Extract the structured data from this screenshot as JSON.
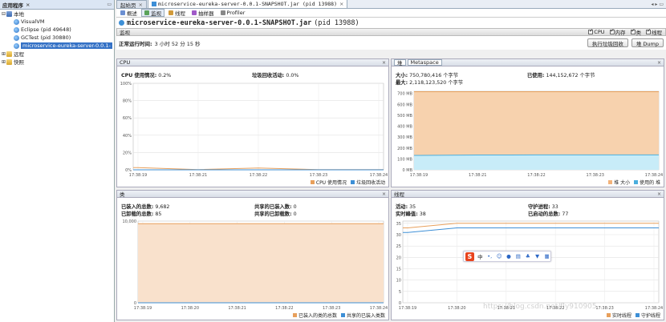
{
  "left_panel": {
    "title": "应用程序",
    "tree": [
      {
        "label": "本地",
        "level": 0,
        "twist": "⊟",
        "icon": "host-icon",
        "selected": false
      },
      {
        "label": "VisualVM",
        "level": 1,
        "twist": "",
        "icon": "app-icon",
        "selected": false
      },
      {
        "label": "Eclipse (pid 49648)",
        "level": 1,
        "twist": "",
        "icon": "app-icon",
        "selected": false
      },
      {
        "label": "GCTest (pid 30880)",
        "level": 1,
        "twist": "",
        "icon": "app-icon",
        "selected": false
      },
      {
        "label": "microservice-eureka-server-0.0.1-",
        "level": 1,
        "twist": "",
        "icon": "app-icon",
        "selected": true
      },
      {
        "label": "远程",
        "level": 0,
        "twist": "⊞",
        "icon": "folder-icon",
        "selected": false
      },
      {
        "label": "快照",
        "level": 0,
        "twist": "⊞",
        "icon": "folder-icon",
        "selected": false
      }
    ]
  },
  "doc_tabs": [
    {
      "label": "起始页",
      "active": false
    },
    {
      "label": "microservice-eureka-server-0.0.1-SNAPSHOT.jar (pid 13988)",
      "active": true
    }
  ],
  "sub_tabs": [
    {
      "label": "概述",
      "active": false,
      "color": "#6b8fd1"
    },
    {
      "label": "监视",
      "active": true,
      "color": "#5aa35a"
    },
    {
      "label": "线程",
      "active": false,
      "color": "#d19a3a"
    },
    {
      "label": "抽样器",
      "active": false,
      "color": "#a05ac8"
    },
    {
      "label": "Profiler",
      "active": false,
      "color": "#888888"
    }
  ],
  "app_title": {
    "name": "microservice-eureka-server-0.0.1-SNAPSHOT.jar",
    "pid": "(pid 13988)"
  },
  "monitor_bar": {
    "label": "监视",
    "checks": [
      {
        "label": "CPU",
        "checked": true
      },
      {
        "label": "内存",
        "checked": true
      },
      {
        "label": "类",
        "checked": true
      },
      {
        "label": "线程",
        "checked": true
      }
    ]
  },
  "uptime": {
    "label": "正常运行时间:",
    "value": "3 小时 52 分 15 秒"
  },
  "buttons": {
    "gc": "执行垃圾回收",
    "heap_dump": "堆 Dump"
  },
  "cpu_panel": {
    "title": "CPU",
    "cpu_usage_label": "CPU 使用情况:",
    "cpu_usage_value": "0.2%",
    "gc_label": "垃圾回收活动:",
    "gc_value": "0.0%",
    "legend": [
      {
        "label": "CPU 使用情况",
        "color": "#e8a05c"
      },
      {
        "label": "垃圾回收活动",
        "color": "#3d8fd6"
      }
    ]
  },
  "heap_panel": {
    "tab_heap": "堆",
    "tab_meta": "Metaspace",
    "size_label": "大小:",
    "size_value": "750,780,416 个字节",
    "used_label": "已使用:",
    "used_value": "144,152,672 个字节",
    "max_label": "最大:",
    "max_value": "2,118,123,520 个字节",
    "legend": [
      {
        "label": "堆 大小",
        "color": "#f2b27a"
      },
      {
        "label": "使用的 堆",
        "color": "#4aaedd"
      }
    ]
  },
  "classes_panel": {
    "title": "类",
    "loaded_label": "已装入的总数:",
    "loaded_value": "9,682",
    "unloaded_label": "已卸载的总数:",
    "unloaded_value": "85",
    "shared_loaded_label": "共享的已装入数:",
    "shared_loaded_value": "0",
    "shared_unloaded_label": "共享的已卸载数:",
    "shared_unloaded_value": "0",
    "legend": [
      {
        "label": "已装入的类的总数",
        "color": "#e8a05c"
      },
      {
        "label": "共享的已装入类数",
        "color": "#3d8fd6"
      }
    ]
  },
  "threads_panel": {
    "title": "线程",
    "live_label": "活动:",
    "live_value": "35",
    "daemon_label": "守护进程:",
    "daemon_value": "33",
    "peak_label": "实时峰值:",
    "peak_value": "38",
    "started_label": "已启动的总数:",
    "started_value": "77",
    "legend": [
      {
        "label": "实时线程",
        "color": "#e8a05c"
      },
      {
        "label": "守护线程",
        "color": "#3d8fd6"
      }
    ]
  },
  "ime_toolbar": {
    "logo": "S",
    "mode": "中"
  },
  "watermark": "https://blog.csdn.net/fly910905",
  "chart_data": [
    {
      "type": "line",
      "title": "CPU",
      "x": [
        "17:38:19",
        "17:38:21",
        "17:38:22",
        "17:38:23",
        "17:38:24"
      ],
      "yticks": [
        "0%",
        "20%",
        "40%",
        "60%",
        "80%",
        "100%"
      ],
      "ylim": [
        0,
        100
      ],
      "series": [
        {
          "name": "CPU 使用情况",
          "values": [
            2.5,
            0.3,
            2.0,
            0.2,
            0.2
          ]
        },
        {
          "name": "垃圾回收活动",
          "values": [
            0,
            0,
            0,
            0,
            0
          ]
        }
      ]
    },
    {
      "type": "area",
      "title": "堆",
      "x": [
        "17:38:19",
        "17:38:21",
        "17:38:22",
        "17:38:23",
        "17:38:24"
      ],
      "yticks": [
        "0 MB",
        "100 MB",
        "200 MB",
        "300 MB",
        "400 MB",
        "500 MB",
        "600 MB",
        "700 MB"
      ],
      "ylim": [
        0,
        720
      ],
      "series": [
        {
          "name": "堆 大小",
          "values": [
            716,
            716,
            716,
            716,
            716
          ]
        },
        {
          "name": "使用的 堆",
          "values": [
            132,
            136,
            137,
            137,
            137
          ]
        }
      ]
    },
    {
      "type": "line",
      "title": "类",
      "x": [
        "17:38:19",
        "17:38:20",
        "17:38:21",
        "17:38:22",
        "17:38:23",
        "17:38:24"
      ],
      "yticks": [
        "0",
        "10,000"
      ],
      "ylim": [
        0,
        10000
      ],
      "series": [
        {
          "name": "已装入的类的总数",
          "values": [
            9682,
            9682,
            9682,
            9682,
            9682,
            9682
          ]
        },
        {
          "name": "共享的已装入类数",
          "values": [
            0,
            0,
            0,
            0,
            0,
            0
          ]
        }
      ]
    },
    {
      "type": "line",
      "title": "线程",
      "x": [
        "17:38:19",
        "17:38:20",
        "17:38:21",
        "17:38:22",
        "17:38:23",
        "17:38:24"
      ],
      "yticks": [
        "0",
        "5",
        "10",
        "15",
        "20",
        "25",
        "30",
        "35"
      ],
      "ylim": [
        0,
        36
      ],
      "series": [
        {
          "name": "实时线程",
          "values": [
            33,
            35,
            35,
            35,
            35,
            35
          ]
        },
        {
          "name": "守护线程",
          "values": [
            31,
            33,
            33,
            33,
            33,
            33
          ]
        }
      ]
    }
  ]
}
